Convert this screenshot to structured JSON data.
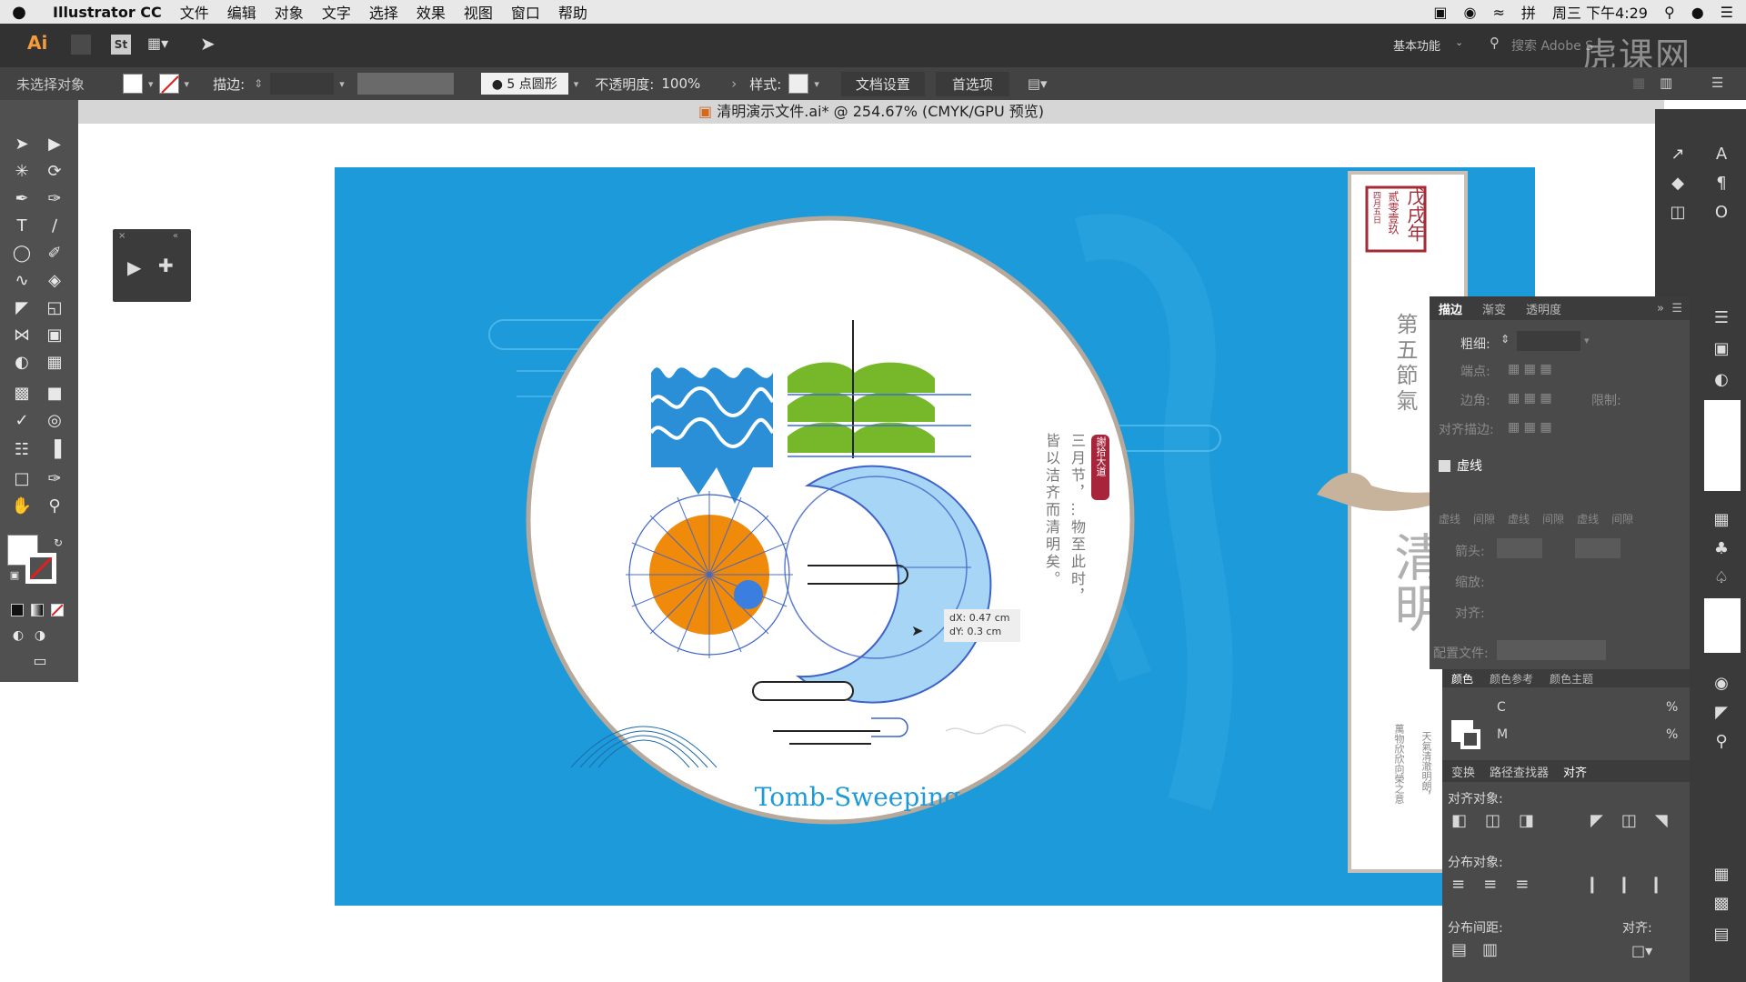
{
  "menubar": {
    "apple": "",
    "app": "Illustrator CC",
    "items": [
      "文件",
      "编辑",
      "对象",
      "文字",
      "选择",
      "效果",
      "视图",
      "窗口",
      "帮助"
    ],
    "datetime": "周三 下午4:29"
  },
  "apptop": {
    "logo": "Ai",
    "st": "St",
    "workspace": "基本功能",
    "search_placeholder": "搜索 Adobe S",
    "watermark": "虎课网"
  },
  "control": {
    "selection": "未选择对象",
    "stroke_label": "描边:",
    "brush": "5 点圆形",
    "opacity_label": "不透明度:",
    "opacity_value": "100%",
    "style_label": "样式:",
    "doc_setup": "文档设置",
    "prefs": "首选项"
  },
  "document": {
    "title": "清明演示文件.ai* @ 254.67% (CMYK/GPU 预览)"
  },
  "artwork": {
    "title": "Tomb-Sweeping",
    "vertical_text_1": "三月节，…物至此时，",
    "vertical_text_2": "皆以洁齐而清明矣。",
    "seal": "謝拾大道",
    "tooltip_dx": "dX: 0.47 cm",
    "tooltip_dy": "dY: 0.3 cm",
    "card": {
      "year": "戊戌年",
      "date": "贰零壹玖",
      "small": "四月五日",
      "solar_term": "第五節氣",
      "big": "清明",
      "foot1": "天氣清澈明朗，",
      "foot2": "萬物欣欣向榮之意"
    }
  },
  "stroke_panel": {
    "tabs": [
      "描边",
      "渐变",
      "透明度"
    ],
    "weight_label": "粗细:",
    "cap_label": "端点:",
    "corner_label": "边角:",
    "limit_label": "限制:",
    "align_label": "对齐描边:",
    "dashed_label": "虚线",
    "dash_labels": [
      "虚线",
      "间隙",
      "虚线",
      "间隙",
      "虚线",
      "间隙"
    ],
    "arrow_label": "箭头:",
    "scale_label": "缩放:",
    "align2_label": "对齐:",
    "profile_label": "配置文件:"
  },
  "color_panel": {
    "tabs": [
      "颜色",
      "颜色参考",
      "颜色主题"
    ],
    "c": "C",
    "m": "M",
    "pct": "%"
  },
  "align_panel": {
    "tabs": [
      "变换",
      "路径查找器",
      "对齐"
    ],
    "align_objects": "对齐对象:",
    "distribute_objects": "分布对象:",
    "distribute_spacing": "分布间距:",
    "align_to": "对齐:"
  },
  "colors": {
    "artboard": "#1d9ad9",
    "orange": "#f08a0a",
    "green": "#76b82a",
    "lightblue": "#a6d5f5",
    "title": "#1d9ad9"
  }
}
